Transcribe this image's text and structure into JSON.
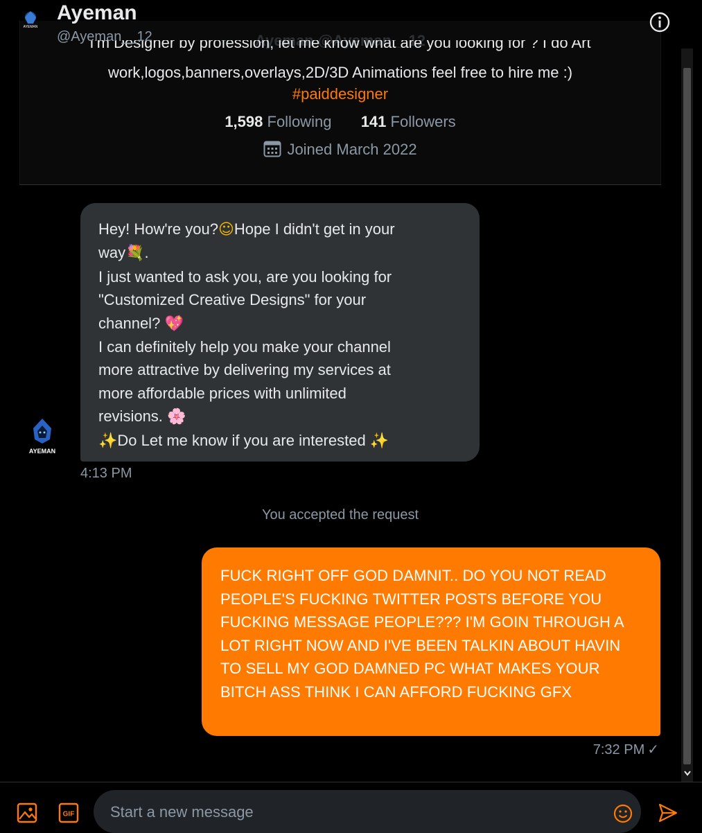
{
  "header": {
    "name": "Ayeman",
    "handle": "@Ayeman__12",
    "avatar_text": "AYEMAN"
  },
  "profile": {
    "ghost_title": "Ayeman @Ayeman__12",
    "bio_line1": "I'm Designer by profession, let me know what are you looking for ? I do Art",
    "bio_line2": "work,logos,banners,overlays,2D/3D Animations feel free to hire me :)",
    "hashtag": "#paiddesigner",
    "following_count": "1,598",
    "following_label": "Following",
    "followers_count": "141",
    "followers_label": "Followers",
    "joined": "Joined March 2022"
  },
  "messages": {
    "incoming": {
      "l1a": "Hey! How're you?",
      "e1": "☺",
      "l1b": "Hope I didn't get in your",
      "l2": "way",
      "e2": "💐",
      "l2b": ".",
      "l3": "I just wanted to ask you, are you looking for",
      "l4": "\"Customized Creative Designs\" for your",
      "l5": "channel?",
      "e3": "💖",
      "l6": "I can definitely help you make your channel",
      "l7": "more attractive by delivering my services at",
      "l8": "more affordable prices with unlimited",
      "l9": "revisions.",
      "e4": "🌸",
      "e5": "✨",
      "l10": "Do Let me know if you are interested",
      "e6": "✨",
      "time": "4:13 PM"
    },
    "system": "You accepted the request",
    "outgoing": {
      "text": "FUCK RIGHT OFF GOD DAMNIT.. DO YOU NOT READ PEOPLE'S FUCKING TWITTER POSTS BEFORE YOU FUCKING MESSAGE PEOPLE??? I'M GOIN THROUGH A LOT RIGHT NOW AND I'VE BEEN TALKIN ABOUT HAVIN TO SELL MY GOD DAMNED PC WHAT MAKES YOUR BITCH ASS THINK I CAN AFFORD FUCKING GFX",
      "time": "7:32 PM",
      "status": "✓"
    }
  },
  "composer": {
    "placeholder": "Start a new message",
    "gif_label": "GIF"
  },
  "colors": {
    "accent": "#ff7a00",
    "background": "#000000",
    "bubble_in": "#2f3336",
    "muted": "#8b98a5"
  },
  "icons": [
    "info-icon",
    "calendar-icon",
    "image-icon",
    "gif-icon",
    "emoji-icon",
    "send-icon",
    "scroll-down-icon"
  ]
}
